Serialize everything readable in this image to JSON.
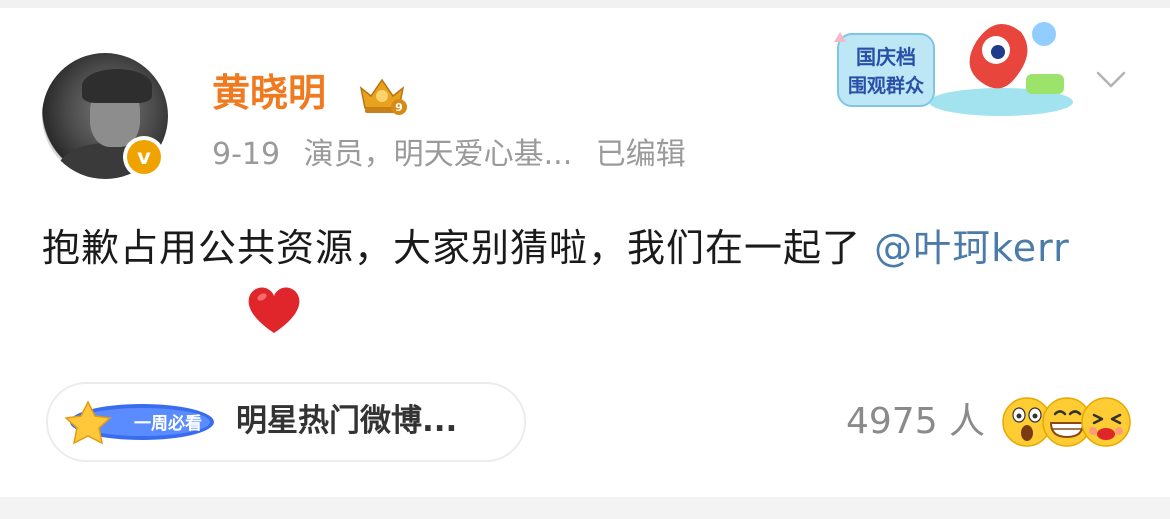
{
  "user": {
    "name": "黄晓明",
    "date": "9-19",
    "description": "演员，明天爱心基...",
    "edited": "已编辑",
    "verified_mark": "v",
    "crown_level": "9"
  },
  "post": {
    "text": "抱歉占用公共资源，大家别猜啦，我们在一起了 ",
    "mention": "@叶珂kerr",
    "heart_icon": "red-heart-icon"
  },
  "promo": {
    "line1": "国庆档",
    "line2": "围观群众"
  },
  "hot_topic": {
    "badge": "一周必看",
    "label": "明星热门微博..."
  },
  "reactions": {
    "count": "4975 人",
    "icons": [
      "surprised-face-icon",
      "grinning-face-icon",
      "laughing-face-icon"
    ]
  },
  "colors": {
    "username": "#f07a1f",
    "mention": "#4a7ba9",
    "meta": "#9a9a9a",
    "verified": "#f0a300"
  }
}
